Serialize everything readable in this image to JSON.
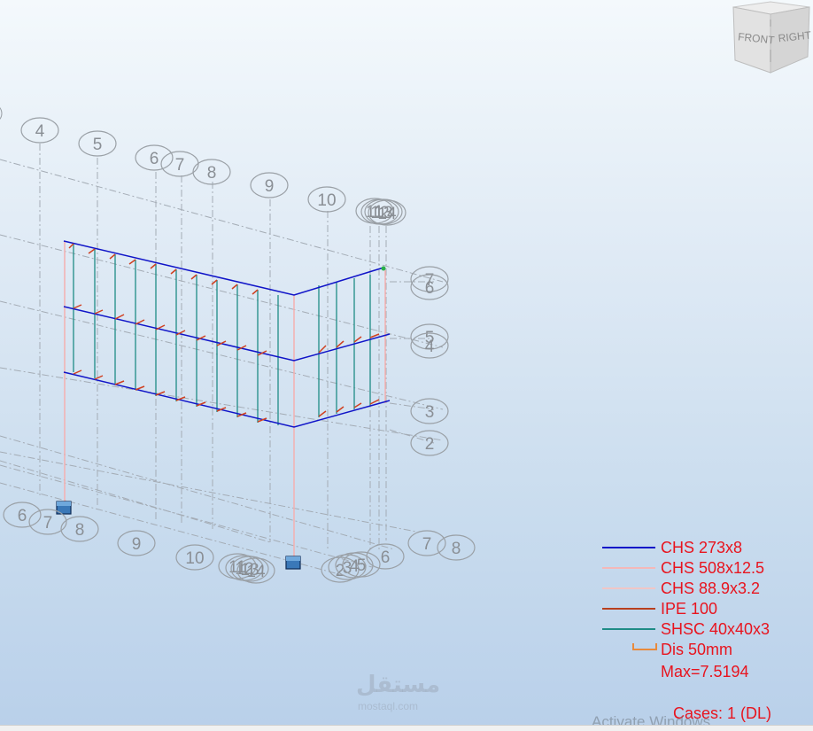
{
  "view_cube": {
    "front_label": "FRONT",
    "right_label": "RIGHT"
  },
  "grid_labels": {
    "top_row": [
      "4",
      "5",
      "6",
      "7",
      "8",
      "9",
      "10",
      "11",
      "12",
      "13",
      "14"
    ],
    "right_column": [
      "7",
      "6",
      "5",
      "4",
      "3",
      "2"
    ],
    "bottom_left": [
      "6",
      "7",
      "8",
      "9",
      "10",
      "11",
      "12",
      "13",
      "14"
    ],
    "bottom_right": [
      "2",
      "3",
      "4",
      "5",
      "6",
      "7",
      "8"
    ]
  },
  "legend": {
    "sections": [
      {
        "label": "CHS 273x8",
        "color": "#1014c8"
      },
      {
        "label": "CHS 508x12.5",
        "color": "#f4b8b8"
      },
      {
        "label": "CHS 88.9x3.2",
        "color": "#f0c6c6"
      },
      {
        "label": "IPE 100",
        "color": "#b8401e"
      },
      {
        "label": "SHSC 40x40x3",
        "color": "#1f8c86"
      }
    ],
    "displacement_label": "Dis  50mm",
    "displacement_color": "#e88a3c",
    "max_label": "Max=7.5194"
  },
  "cases_label": "Cases: 1 (DL)",
  "os_watermark": "Activate Windows",
  "site_watermark": "مستقل",
  "site_watermark_sub": "mostaql.com",
  "colors": {
    "grid_line": "#a0a8b0",
    "bubble_stroke": "#9aa0a6",
    "bubble_text": "#8a8f95",
    "legend_text": "#e8141e",
    "support": "#3a78b8"
  }
}
